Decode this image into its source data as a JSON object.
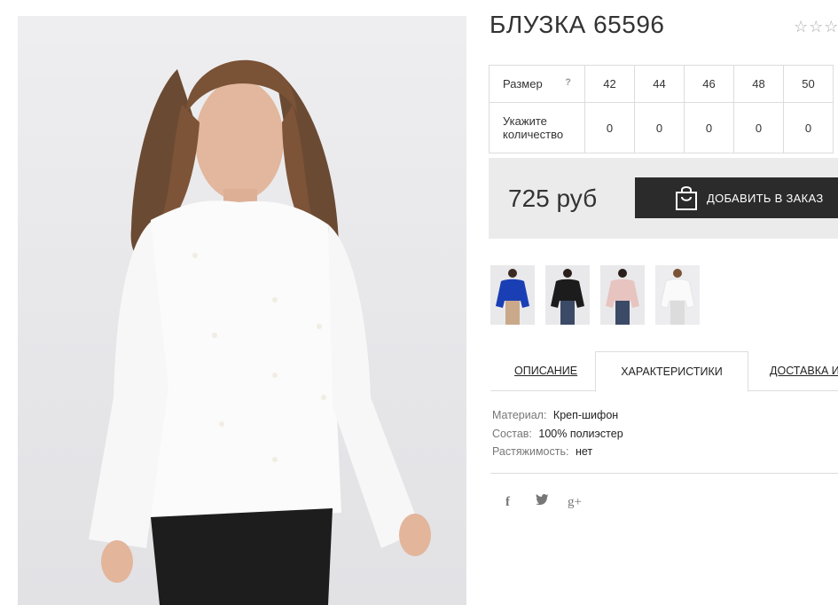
{
  "product": {
    "title": "БЛУЗКА 65596",
    "rating_stars": "☆☆☆"
  },
  "sizes": {
    "row_label": "Размер",
    "help_label": "?",
    "values": [
      "42",
      "44",
      "46",
      "48",
      "50"
    ],
    "qty_label": "Укажите количество",
    "quantities": [
      "0",
      "0",
      "0",
      "0",
      "0"
    ]
  },
  "purchase": {
    "price": "725 руб",
    "add_button_label": "ДОБАВИТЬ В ЗАКАЗ"
  },
  "thumbnails": [
    {
      "color_name": "blue",
      "color": "#1a3fb5"
    },
    {
      "color_name": "black",
      "color": "#1c1c1c"
    },
    {
      "color_name": "pink",
      "color": "#e7c4c0"
    },
    {
      "color_name": "white",
      "color": "#f6f6f6"
    }
  ],
  "tabs": [
    {
      "label": "ОПИСАНИЕ",
      "active": false
    },
    {
      "label": "ХАРАКТЕРИСТИКИ",
      "active": true
    },
    {
      "label": "ДОСТАВКА И",
      "active": false
    }
  ],
  "characteristics": [
    {
      "key": "Материал:",
      "value": "Креп-шифон"
    },
    {
      "key": "Состав:",
      "value": "100% полиэстер"
    },
    {
      "key": "Растяжимость:",
      "value": "нет"
    }
  ],
  "social": [
    {
      "name": "facebook-icon",
      "glyph": "f"
    },
    {
      "name": "twitter-icon",
      "glyph": "t"
    },
    {
      "name": "google-plus-icon",
      "glyph": "g+"
    }
  ],
  "colors": {
    "button_bg": "#2b2b2b",
    "panel_bg": "#ebebeb",
    "border": "#dcdcdc"
  }
}
